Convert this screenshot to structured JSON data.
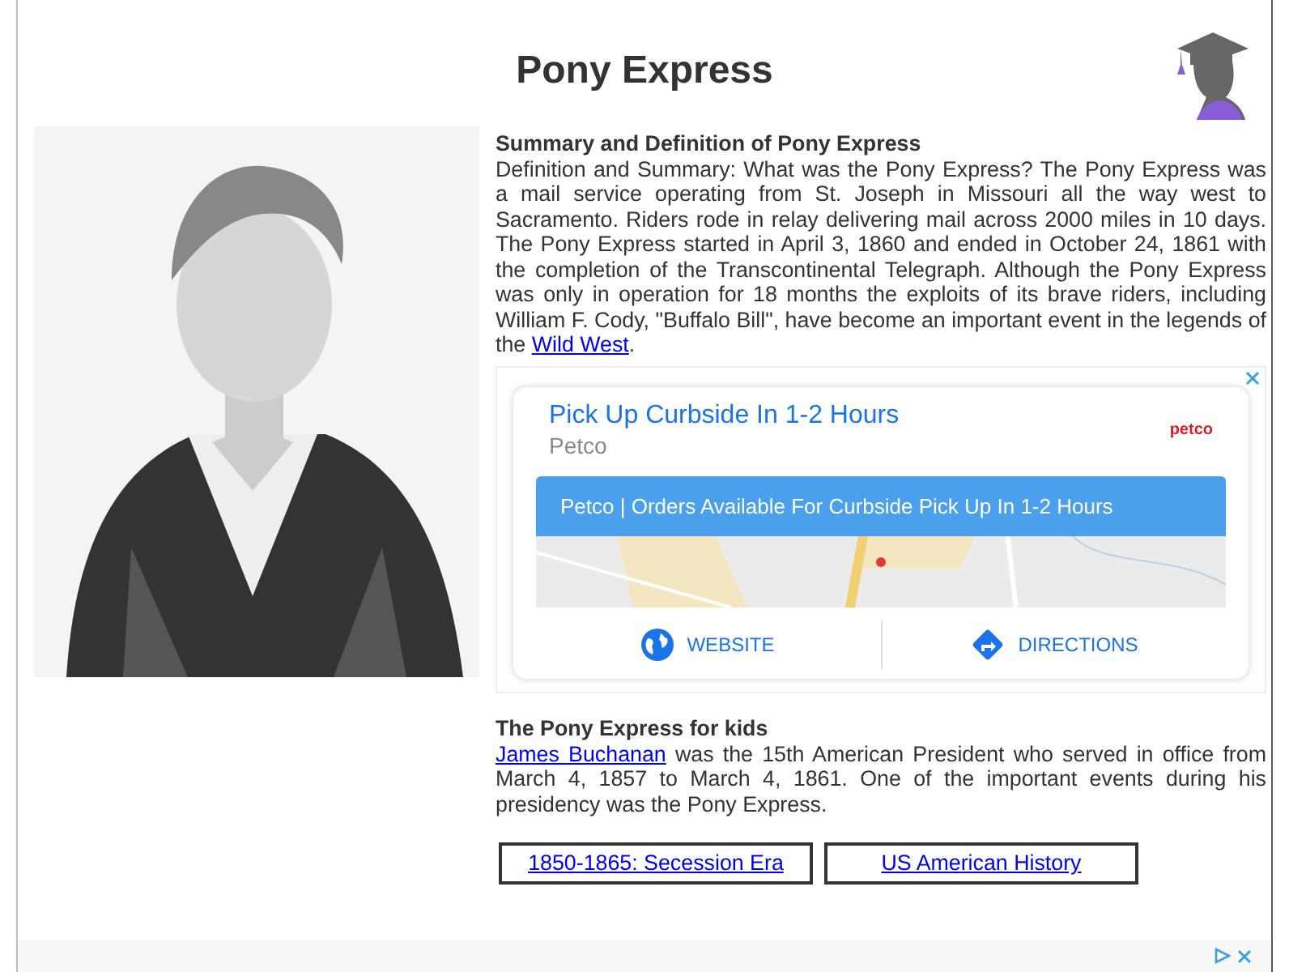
{
  "title": "Pony Express",
  "summary": {
    "heading": "Summary and Definition of Pony Express",
    "text": "Definition and Summary: What was the Pony Express? The Pony Express was a mail service operating from St. Joseph in Missouri all the way west to Sacramento. Riders rode in relay delivering mail across 2000 miles in 10 days. The Pony Express started in April 3, 1860 and ended in October 24, 1861 with the completion of the Transcontinental Telegraph. Although the Pony Express was only in operation for 18 months the exploits of its brave riders, including William F. Cody, \"Buffalo Bill\", have become an important event in the legends of the",
    "link": "Wild West",
    "after": "."
  },
  "ad": {
    "headline": "Pick Up Curbside In 1-2 Hours",
    "advertiser": "Petco",
    "logo": "petco",
    "banner": "Petco | Orders Available For Curbside Pick Up In 1-2 Hours",
    "actions": [
      {
        "kind": "website",
        "label": "WEBSITE"
      },
      {
        "kind": "directions",
        "label": "DIRECTIONS"
      }
    ]
  },
  "kids": {
    "heading": "The Pony Express for kids",
    "link": "James Buchanan",
    "text": " was the 15th American President who served in office from March 4, 1857 to March 4, 1861. One of the important events during his presidency was the Pony Express."
  },
  "nav_links": [
    "1850-1865: Secession Era",
    "US American History"
  ]
}
